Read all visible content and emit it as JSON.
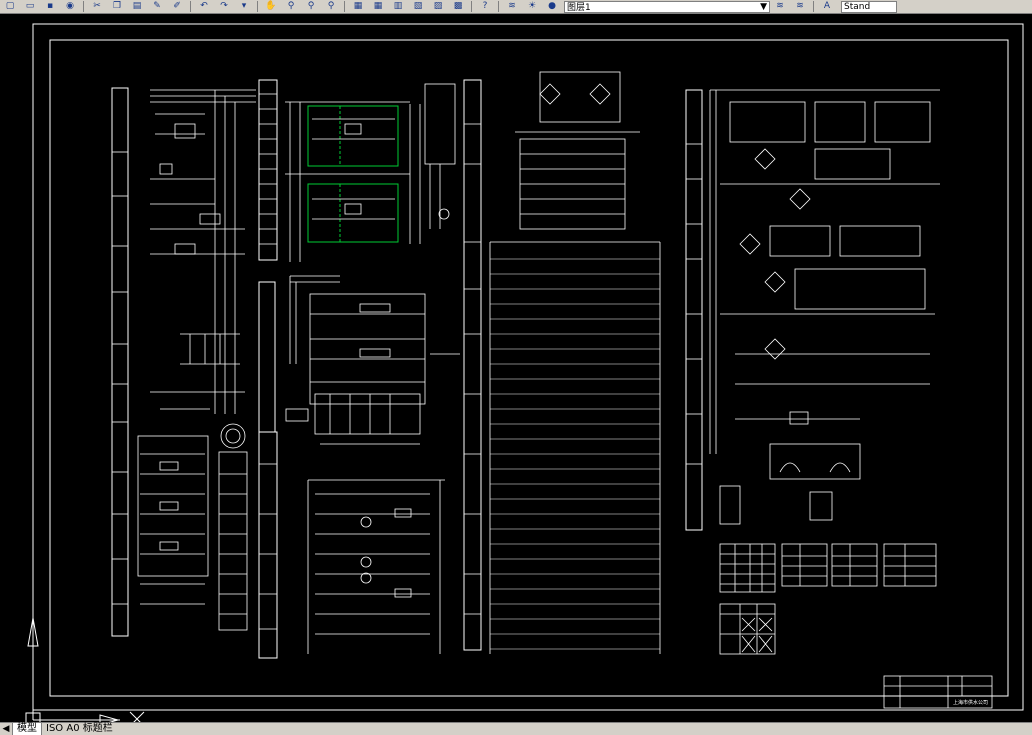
{
  "toolbar": {
    "layer_name": "图层1",
    "text_style": "Stand",
    "help_label": "?",
    "icons": [
      "new-icon",
      "open-icon",
      "save-icon",
      "publish-icon",
      "cut-icon",
      "copy-icon",
      "paste-icon",
      "match-prop-icon",
      "undo-icon",
      "redo-icon",
      "pan-icon",
      "zoom-realtime-icon",
      "zoom-window-icon",
      "zoom-previous-icon",
      "properties-icon",
      "design-center-icon",
      "tool-palette-icon",
      "sheet-set-icon",
      "markup-icon",
      "calculator-icon",
      "help-icon",
      "layer-manager-icon",
      "layer-state-icon",
      "layer-previous-icon"
    ]
  },
  "tabs": {
    "model": "模型",
    "layout1": "ISO A0 标题栏"
  },
  "drawing": {
    "colors": {
      "background": "#000000",
      "lines": "#ffffff",
      "block_highlight": "#00cc33"
    },
    "labels": {
      "title_block_name": "上海市供水公司"
    }
  }
}
